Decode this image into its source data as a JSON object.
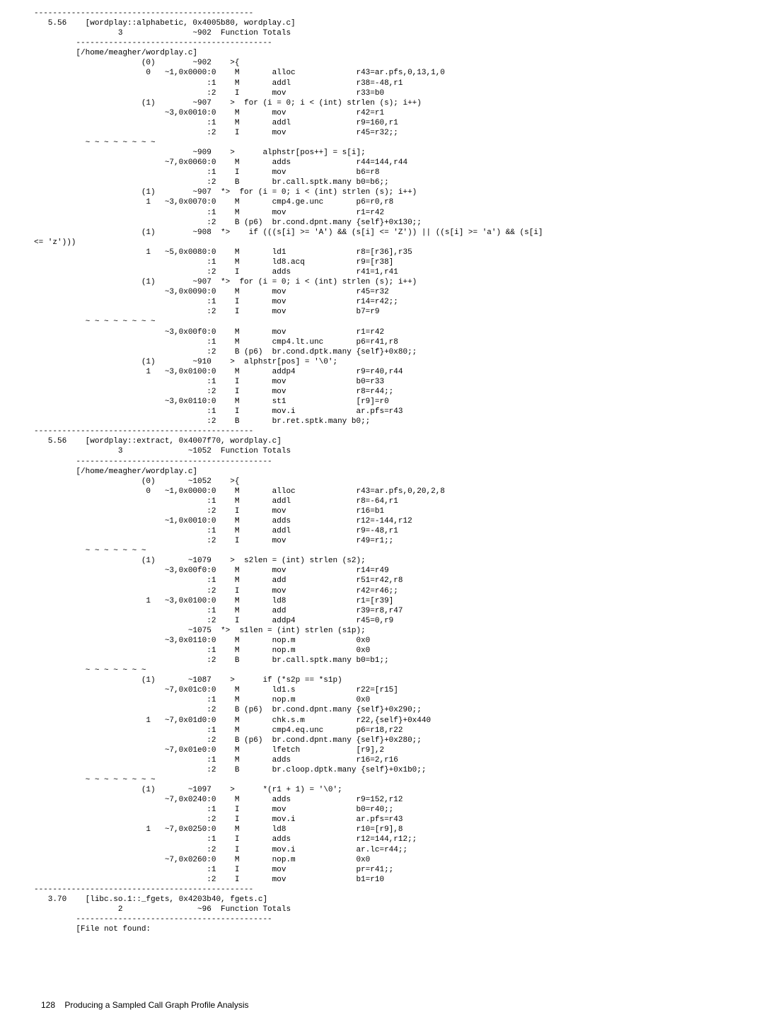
{
  "footer": {
    "page": "128",
    "title": "Producing a Sampled Call Graph Profile Analysis"
  },
  "lines": [
    "-----------------------------------------------",
    "   5.56    [wordplay::alphabetic, 0x4005b80, wordplay.c]",
    "                  3               ~902  Function Totals",
    "         ------------------------------------------",
    "         [/home/meagher/wordplay.c]",
    "                       (0)        ~902    >{",
    "                        0   ~1,0x0000:0    M       alloc             r43=ar.pfs,0,13,1,0",
    "                                     :1    M       addl              r38=-48,r1",
    "                                     :2    I       mov               r33=b0",
    "                       (1)        ~907    >  for (i = 0; i < (int) strlen (s); i++)",
    "                            ~3,0x0010:0    M       mov               r42=r1",
    "                                     :1    M       addl              r9=160,r1",
    "                                     :2    I       mov               r45=r32;;",
    "           ~ ~ ~ ~ ~ ~ ~ ~",
    "                                  ~909    >      alphstr[pos++] = s[i];",
    "                            ~7,0x0060:0    M       adds              r44=144,r44",
    "                                     :1    I       mov               b6=r8",
    "                                     :2    B       br.call.sptk.many b0=b6;;",
    "                       (1)        ~907  *>  for (i = 0; i < (int) strlen (s); i++)",
    "                        1   ~3,0x0070:0    M       cmp4.ge.unc       p6=r0,r8",
    "                                     :1    M       mov               r1=r42",
    "                                     :2    B (p6)  br.cond.dpnt.many {self}+0x130;;",
    "                       (1)        ~908  *>    if (((s[i] >= 'A') && (s[i] <= 'Z')) || ((s[i] >= 'a') && (s[i]",
    "<= 'z')))",
    "                        1   ~5,0x0080:0    M       ld1               r8=[r36],r35",
    "                                     :1    M       ld8.acq           r9=[r38]",
    "                                     :2    I       adds              r41=1,r41",
    "                       (1)        ~907  *>  for (i = 0; i < (int) strlen (s); i++)",
    "                            ~3,0x0090:0    M       mov               r45=r32",
    "                                     :1    I       mov               r14=r42;;",
    "                                     :2    I       mov               b7=r9",
    "           ~ ~ ~ ~ ~ ~ ~ ~",
    "                            ~3,0x00f0:0    M       mov               r1=r42",
    "                                     :1    M       cmp4.lt.unc       p6=r41,r8",
    "                                     :2    B (p6)  br.cond.dptk.many {self}+0x80;;",
    "                       (1)        ~910    >  alphstr[pos] = '\\0';",
    "                        1   ~3,0x0100:0    M       addp4             r9=r40,r44",
    "                                     :1    I       mov               b0=r33",
    "                                     :2    I       mov               r8=r44;;",
    "                            ~3,0x0110:0    M       st1               [r9]=r0",
    "                                     :1    I       mov.i             ar.pfs=r43",
    "                                     :2    B       br.ret.sptk.many b0;;",
    "-----------------------------------------------",
    "   5.56    [wordplay::extract, 0x4007f70, wordplay.c]",
    "                  3              ~1052  Function Totals",
    "         ------------------------------------------",
    "         [/home/meagher/wordplay.c]",
    "                       (0)       ~1052    >{",
    "                        0   ~1,0x0000:0    M       alloc             r43=ar.pfs,0,20,2,8",
    "                                     :1    M       addl              r8=-64,r1",
    "                                     :2    I       mov               r16=b1",
    "                            ~1,0x0010:0    M       adds              r12=-144,r12",
    "                                     :1    M       addl              r9=-48,r1",
    "                                     :2    I       mov               r49=r1;;",
    "           ~ ~ ~ ~ ~ ~ ~",
    "                       (1)       ~1079    >  s2len = (int) strlen (s2);",
    "                            ~3,0x00f0:0    M       mov               r14=r49",
    "                                     :1    M       add               r51=r42,r8",
    "                                     :2    I       mov               r42=r46;;",
    "                        1   ~3,0x0100:0    M       ld8               r1=[r39]",
    "                                     :1    M       add               r39=r8,r47",
    "                                     :2    I       addp4             r45=0,r9",
    "                                 ~1075  *>  s1len = (int) strlen (s1p);",
    "                            ~3,0x0110:0    M       nop.m             0x0",
    "                                     :1    M       nop.m             0x0",
    "                                     :2    B       br.call.sptk.many b0=b1;;",
    "           ~ ~ ~ ~ ~ ~ ~",
    "                       (1)       ~1087    >      if (*s2p == *s1p)",
    "                            ~7,0x01c0:0    M       ld1.s             r22=[r15]",
    "                                     :1    M       nop.m             0x0",
    "                                     :2    B (p6)  br.cond.dpnt.many {self}+0x290;;",
    "                        1   ~7,0x01d0:0    M       chk.s.m           r22,{self}+0x440",
    "                                     :1    M       cmp4.eq.unc       p6=r18,r22",
    "                                     :2    B (p6)  br.cond.dpnt.many {self}+0x280;;",
    "                            ~7,0x01e0:0    M       lfetch            [r9],2",
    "                                     :1    M       adds              r16=2,r16",
    "                                     :2    B       br.cloop.dptk.many {self}+0x1b0;;",
    "           ~ ~ ~ ~ ~ ~ ~ ~",
    "                       (1)       ~1097    >      *(r1 + 1) = '\\0';",
    "                            ~7,0x0240:0    M       adds              r9=152,r12",
    "                                     :1    I       mov               b0=r40;;",
    "                                     :2    I       mov.i             ar.pfs=r43",
    "                        1   ~7,0x0250:0    M       ld8               r10=[r9],8",
    "                                     :1    I       adds              r12=144,r12;;",
    "                                     :2    I       mov.i             ar.lc=r44;;",
    "                            ~7,0x0260:0    M       nop.m             0x0",
    "                                     :1    I       mov               pr=r41;;",
    "                                     :2    I       mov               b1=r10",
    "-----------------------------------------------",
    "   3.70    [libc.so.1::_fgets, 0x4203b40, fgets.c]",
    "                  2                ~96  Function Totals",
    "         ------------------------------------------",
    "         [File not found:",
    "",
    "",
    "",
    "",
    "",
    ""
  ]
}
